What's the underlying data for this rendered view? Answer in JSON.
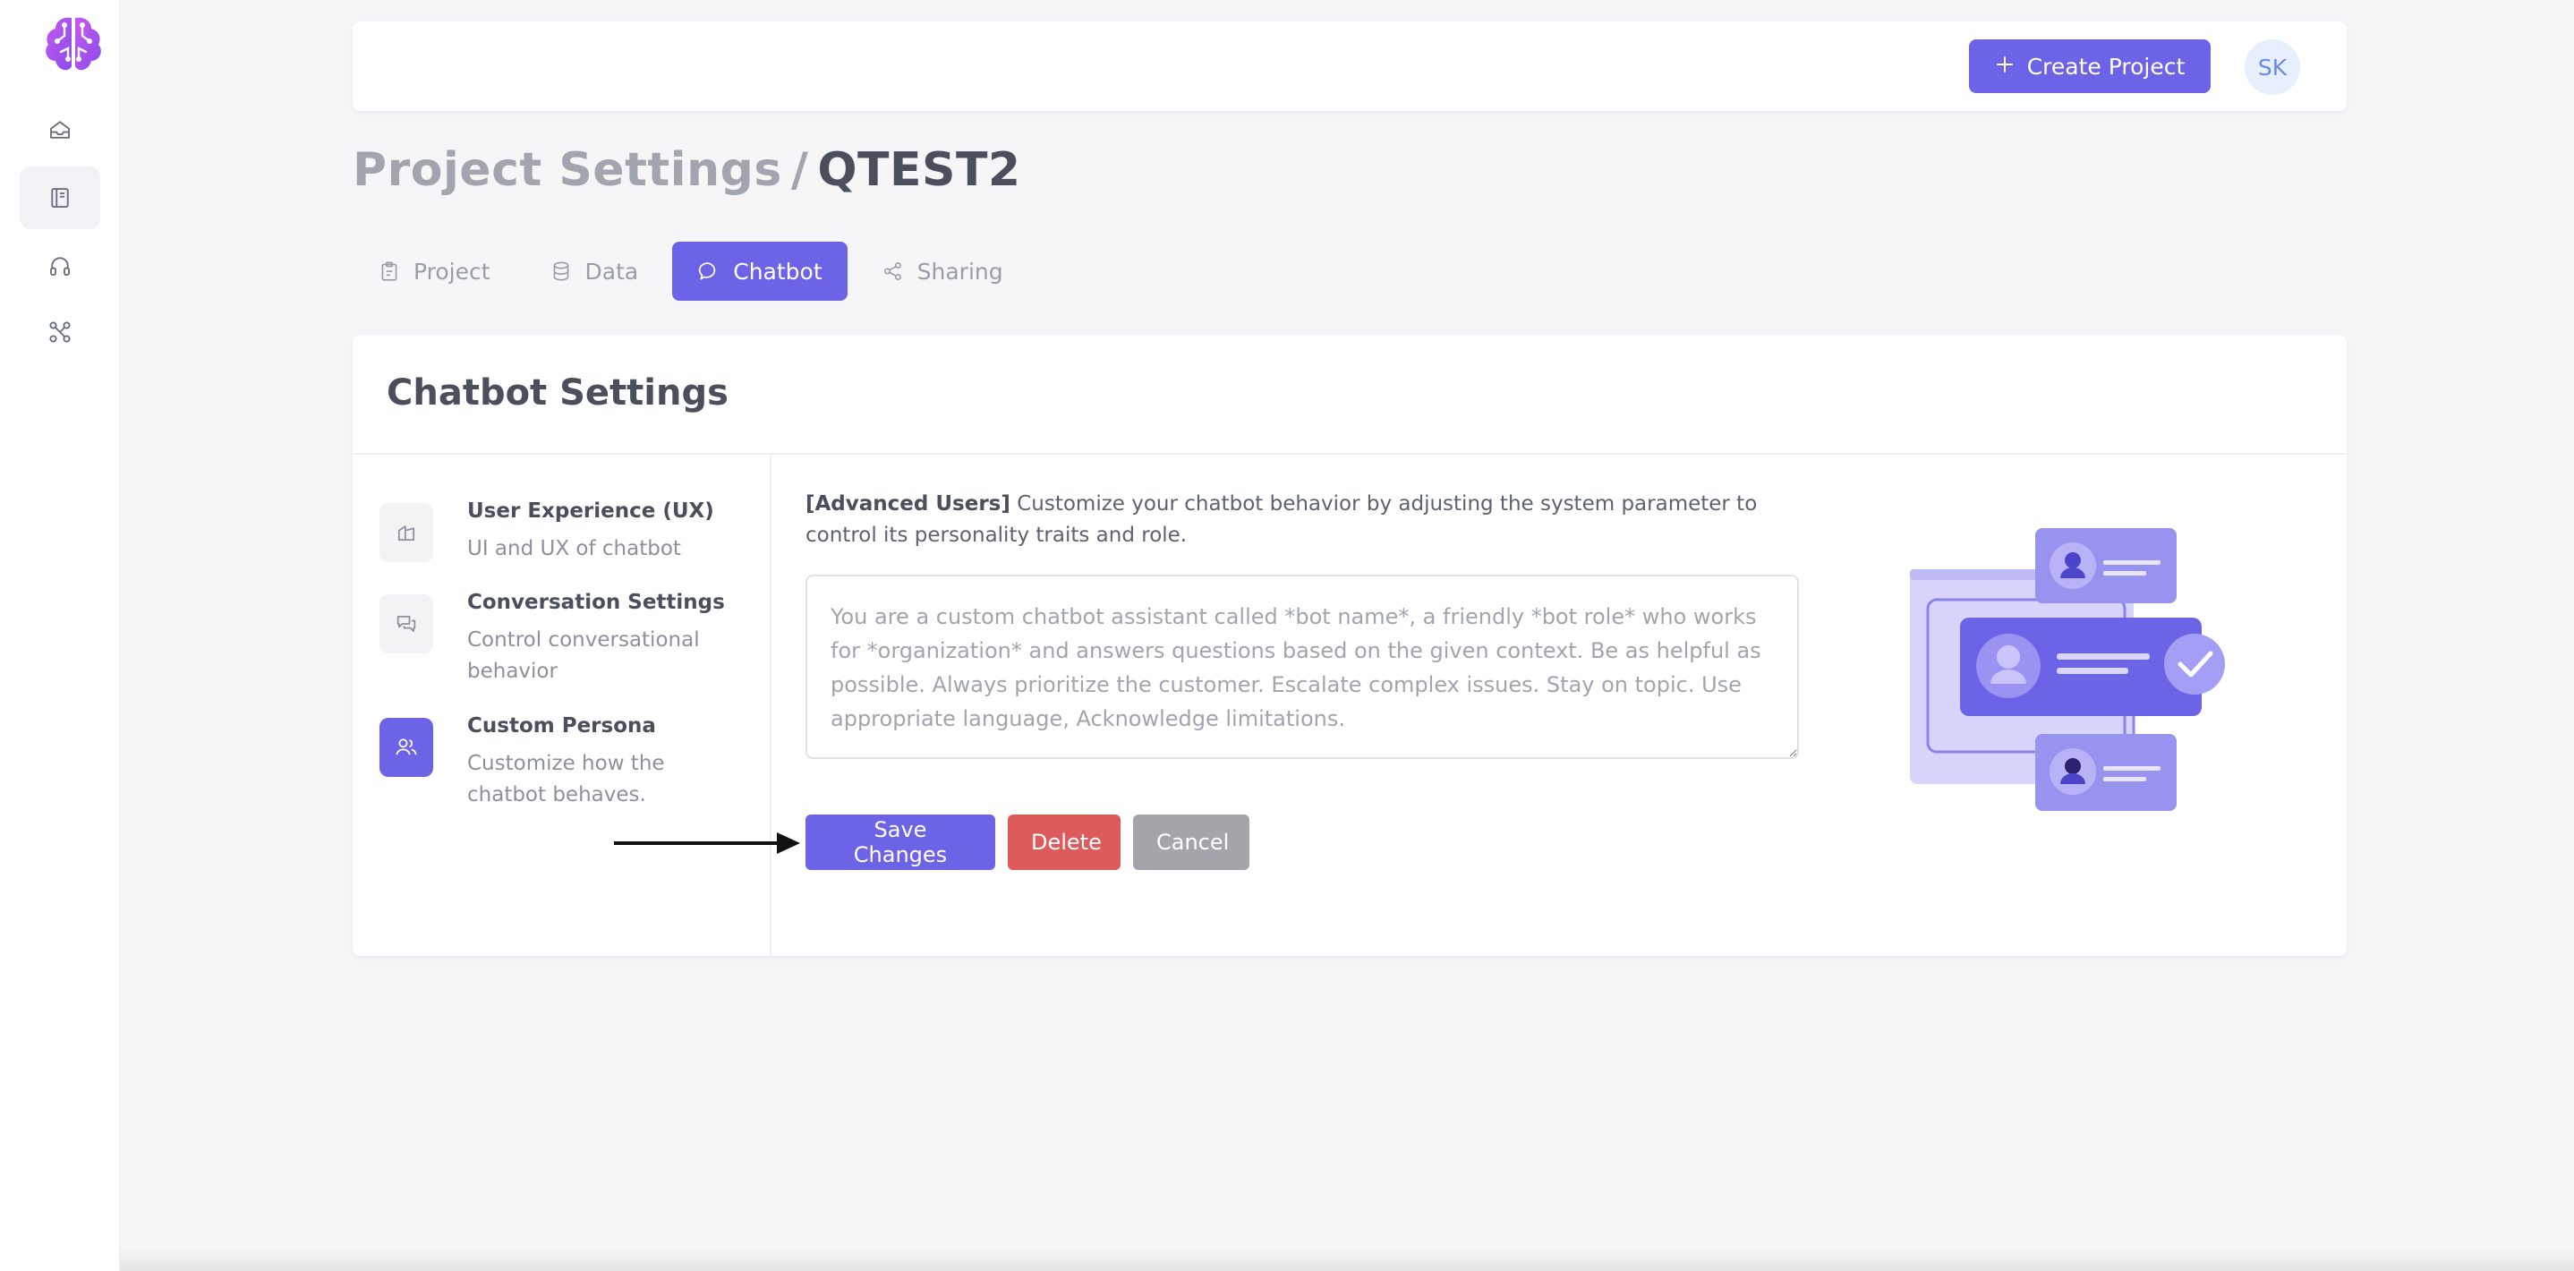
{
  "nav": {
    "logo": "brain-circuit-logo",
    "items": [
      {
        "icon": "home-icon",
        "active": false
      },
      {
        "icon": "book-icon",
        "active": true
      },
      {
        "icon": "headphones-icon",
        "active": false
      },
      {
        "icon": "integrations-icon",
        "active": false
      }
    ]
  },
  "header": {
    "create_project_label": "Create Project",
    "avatar_initials": "SK"
  },
  "breadcrumb": {
    "section": "Project Settings",
    "separator": "/",
    "current": "QTEST2"
  },
  "tabs": [
    {
      "label": "Project",
      "icon": "clipboard-icon",
      "active": false
    },
    {
      "label": "Data",
      "icon": "database-icon",
      "active": false
    },
    {
      "label": "Chatbot",
      "icon": "chat-bubble-icon",
      "active": true
    },
    {
      "label": "Sharing",
      "icon": "share-icon",
      "active": false
    }
  ],
  "card": {
    "title": "Chatbot Settings",
    "side_items": [
      {
        "title": "User Experience (UX)",
        "desc": "UI and UX of chatbot",
        "icon": "ux-icon",
        "active": false
      },
      {
        "title": "Conversation Settings",
        "desc": "Control conversational behavior",
        "icon": "conversation-icon",
        "active": false
      },
      {
        "title": "Custom Persona",
        "desc": "Customize how the chatbot behaves.",
        "icon": "users-icon",
        "active": true
      }
    ],
    "description_prefix": "[Advanced Users]",
    "description_text": " Customize your chatbot behavior by adjusting the system parameter to control its personality traits and role.",
    "persona_value": "",
    "persona_placeholder": "You are a custom chatbot assistant called *bot name*, a friendly *bot role* who works for *organization* and answers questions based on the given context. Be as helpful as possible. Always prioritize the customer. Escalate complex issues. Stay on topic. Use appropriate language, Acknowledge limitations.",
    "save_label": "Save Changes",
    "delete_label": "Delete",
    "cancel_label": "Cancel",
    "illustration": "chatbot-persona-illustration"
  },
  "colors": {
    "accent": "#6c63e6",
    "danger": "#dd5b5b",
    "muted": "#a4a5ab",
    "background": "#f6f6f9"
  }
}
